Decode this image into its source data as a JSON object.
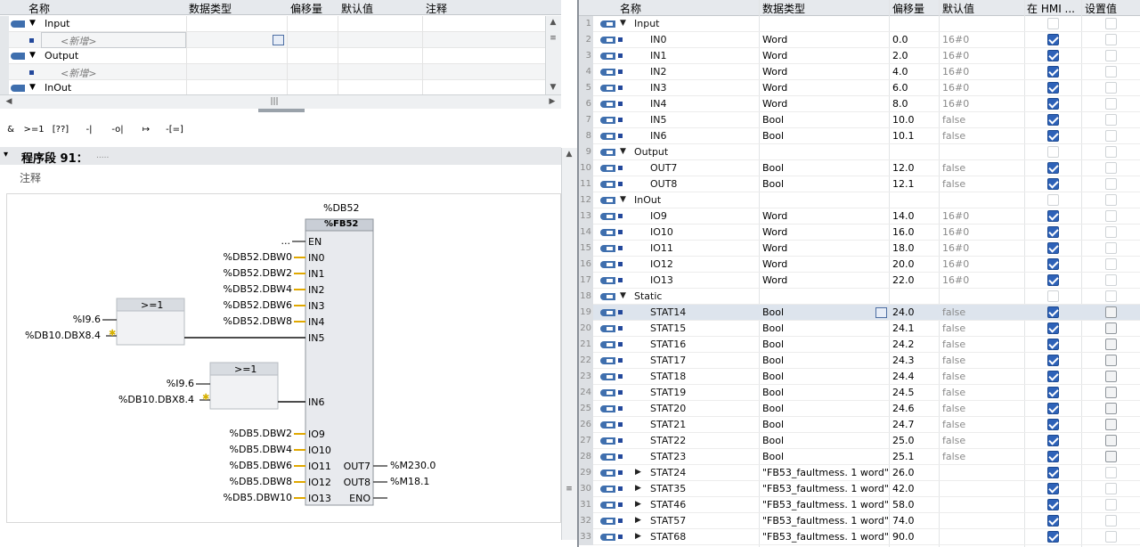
{
  "left_interface": {
    "headers": [
      "名称",
      "数据类型",
      "偏移量",
      "默认值",
      "注释"
    ],
    "rows": [
      {
        "kind": "section",
        "label": "Input"
      },
      {
        "kind": "new",
        "label": "<新增>"
      },
      {
        "kind": "section",
        "label": "Output"
      },
      {
        "kind": "new",
        "label": "<新增>"
      },
      {
        "kind": "section",
        "label": "InOut"
      }
    ]
  },
  "toolbar": {
    "items": [
      "&",
      ">=1",
      "[??]",
      "-|",
      "-o|",
      "↦",
      "-[=]"
    ]
  },
  "network": {
    "title": "程序段 91：",
    "title_dots": ".....",
    "comment": "注释"
  },
  "block": {
    "instance": "%DB52",
    "name": "%FB52",
    "en_input": "...",
    "inputs": [
      {
        "pin": "EN",
        "signal": "..."
      },
      {
        "pin": "IN0",
        "signal": "%DB52.DBW0"
      },
      {
        "pin": "IN1",
        "signal": "%DB52.DBW2"
      },
      {
        "pin": "IN2",
        "signal": "%DB52.DBW4"
      },
      {
        "pin": "IN3",
        "signal": "%DB52.DBW6"
      },
      {
        "pin": "IN4",
        "signal": "%DB52.DBW8"
      },
      {
        "pin": "IN5",
        "signal": ""
      },
      {
        "pin": "IN6",
        "signal": ""
      },
      {
        "pin": "IO9",
        "signal": "%DB5.DBW2"
      },
      {
        "pin": "IO10",
        "signal": "%DB5.DBW4"
      },
      {
        "pin": "IO11",
        "signal": "%DB5.DBW6"
      },
      {
        "pin": "IO12",
        "signal": "%DB5.DBW8"
      },
      {
        "pin": "IO13",
        "signal": "%DB5.DBW10"
      }
    ],
    "outputs": [
      {
        "pin": "OUT7",
        "signal": "%M230.0"
      },
      {
        "pin": "OUT8",
        "signal": "%M18.1"
      },
      {
        "pin": "ENO",
        "signal": ""
      }
    ]
  },
  "or_gates": [
    {
      "label": ">=1",
      "in1": "%I9.6",
      "in2": "%DB10.DBX8.4"
    },
    {
      "label": ">=1",
      "in1": "%I9.6",
      "in2": "%DB10.DBX8.4"
    }
  ],
  "right_table": {
    "headers": [
      "名称",
      "数据类型",
      "偏移量",
      "默认值",
      "在 HMI ...",
      "设置值"
    ],
    "rows": [
      {
        "n": "1",
        "kind": "section",
        "name": "Input",
        "type": "",
        "offset": "",
        "def": "",
        "hmi": "dis",
        "set": "dis"
      },
      {
        "n": "2",
        "kind": "var",
        "name": "IN0",
        "type": "Word",
        "offset": "0.0",
        "def": "16#0",
        "hmi": "on",
        "set": "dis"
      },
      {
        "n": "3",
        "kind": "var",
        "name": "IN1",
        "type": "Word",
        "offset": "2.0",
        "def": "16#0",
        "hmi": "on",
        "set": "dis"
      },
      {
        "n": "4",
        "kind": "var",
        "name": "IN2",
        "type": "Word",
        "offset": "4.0",
        "def": "16#0",
        "hmi": "on",
        "set": "dis"
      },
      {
        "n": "5",
        "kind": "var",
        "name": "IN3",
        "type": "Word",
        "offset": "6.0",
        "def": "16#0",
        "hmi": "on",
        "set": "dis"
      },
      {
        "n": "6",
        "kind": "var",
        "name": "IN4",
        "type": "Word",
        "offset": "8.0",
        "def": "16#0",
        "hmi": "on",
        "set": "dis"
      },
      {
        "n": "7",
        "kind": "var",
        "name": "IN5",
        "type": "Bool",
        "offset": "10.0",
        "def": "false",
        "hmi": "on",
        "set": "dis"
      },
      {
        "n": "8",
        "kind": "var",
        "name": "IN6",
        "type": "Bool",
        "offset": "10.1",
        "def": "false",
        "hmi": "on",
        "set": "dis"
      },
      {
        "n": "9",
        "kind": "section",
        "name": "Output",
        "type": "",
        "offset": "",
        "def": "",
        "hmi": "dis",
        "set": "dis"
      },
      {
        "n": "10",
        "kind": "var",
        "name": "OUT7",
        "type": "Bool",
        "offset": "12.0",
        "def": "false",
        "hmi": "on",
        "set": "dis"
      },
      {
        "n": "11",
        "kind": "var",
        "name": "OUT8",
        "type": "Bool",
        "offset": "12.1",
        "def": "false",
        "hmi": "on",
        "set": "dis"
      },
      {
        "n": "12",
        "kind": "section",
        "name": "InOut",
        "type": "",
        "offset": "",
        "def": "",
        "hmi": "dis",
        "set": "dis"
      },
      {
        "n": "13",
        "kind": "var",
        "name": "IO9",
        "type": "Word",
        "offset": "14.0",
        "def": "16#0",
        "hmi": "on",
        "set": "dis"
      },
      {
        "n": "14",
        "kind": "var",
        "name": "IO10",
        "type": "Word",
        "offset": "16.0",
        "def": "16#0",
        "hmi": "on",
        "set": "dis"
      },
      {
        "n": "15",
        "kind": "var",
        "name": "IO11",
        "type": "Word",
        "offset": "18.0",
        "def": "16#0",
        "hmi": "on",
        "set": "dis"
      },
      {
        "n": "16",
        "kind": "var",
        "name": "IO12",
        "type": "Word",
        "offset": "20.0",
        "def": "16#0",
        "hmi": "on",
        "set": "dis"
      },
      {
        "n": "17",
        "kind": "var",
        "name": "IO13",
        "type": "Word",
        "offset": "22.0",
        "def": "16#0",
        "hmi": "on",
        "set": "dis"
      },
      {
        "n": "18",
        "kind": "section",
        "name": "Static",
        "type": "",
        "offset": "",
        "def": "",
        "hmi": "dis",
        "set": "dis"
      },
      {
        "n": "19",
        "kind": "var",
        "name": "STAT14",
        "type": "Bool",
        "offset": "24.0",
        "def": "false",
        "hmi": "on",
        "set": "sq",
        "selected": true
      },
      {
        "n": "20",
        "kind": "var",
        "name": "STAT15",
        "type": "Bool",
        "offset": "24.1",
        "def": "false",
        "hmi": "on",
        "set": "sq"
      },
      {
        "n": "21",
        "kind": "var",
        "name": "STAT16",
        "type": "Bool",
        "offset": "24.2",
        "def": "false",
        "hmi": "on",
        "set": "sq"
      },
      {
        "n": "22",
        "kind": "var",
        "name": "STAT17",
        "type": "Bool",
        "offset": "24.3",
        "def": "false",
        "hmi": "on",
        "set": "sq"
      },
      {
        "n": "23",
        "kind": "var",
        "name": "STAT18",
        "type": "Bool",
        "offset": "24.4",
        "def": "false",
        "hmi": "on",
        "set": "sq"
      },
      {
        "n": "24",
        "kind": "var",
        "name": "STAT19",
        "type": "Bool",
        "offset": "24.5",
        "def": "false",
        "hmi": "on",
        "set": "sq"
      },
      {
        "n": "25",
        "kind": "var",
        "name": "STAT20",
        "type": "Bool",
        "offset": "24.6",
        "def": "false",
        "hmi": "on",
        "set": "sq"
      },
      {
        "n": "26",
        "kind": "var",
        "name": "STAT21",
        "type": "Bool",
        "offset": "24.7",
        "def": "false",
        "hmi": "on",
        "set": "sq"
      },
      {
        "n": "27",
        "kind": "var",
        "name": "STAT22",
        "type": "Bool",
        "offset": "25.0",
        "def": "false",
        "hmi": "on",
        "set": "sq"
      },
      {
        "n": "28",
        "kind": "var",
        "name": "STAT23",
        "type": "Bool",
        "offset": "25.1",
        "def": "false",
        "hmi": "on",
        "set": "sq"
      },
      {
        "n": "29",
        "kind": "struct",
        "name": "STAT24",
        "type": "\"FB53_faultmess. 1 word\"",
        "offset": "26.0",
        "def": "",
        "hmi": "on",
        "set": "dis"
      },
      {
        "n": "30",
        "kind": "struct",
        "name": "STAT35",
        "type": "\"FB53_faultmess. 1 word\"",
        "offset": "42.0",
        "def": "",
        "hmi": "on",
        "set": "dis"
      },
      {
        "n": "31",
        "kind": "struct",
        "name": "STAT46",
        "type": "\"FB53_faultmess. 1 word\"",
        "offset": "58.0",
        "def": "",
        "hmi": "on",
        "set": "dis"
      },
      {
        "n": "32",
        "kind": "struct",
        "name": "STAT57",
        "type": "\"FB53_faultmess. 1 word\"",
        "offset": "74.0",
        "def": "",
        "hmi": "on",
        "set": "dis"
      },
      {
        "n": "33",
        "kind": "struct",
        "name": "STAT68",
        "type": "\"FB53_faultmess. 1 word\"",
        "offset": "90.0",
        "def": "",
        "hmi": "on",
        "set": "dis"
      }
    ]
  },
  "colors": {
    "accent": "#2e62b8",
    "header_bg": "#e6e9ed",
    "wire_yellow": "#e0a800",
    "block_bg": "#e8eaee"
  }
}
